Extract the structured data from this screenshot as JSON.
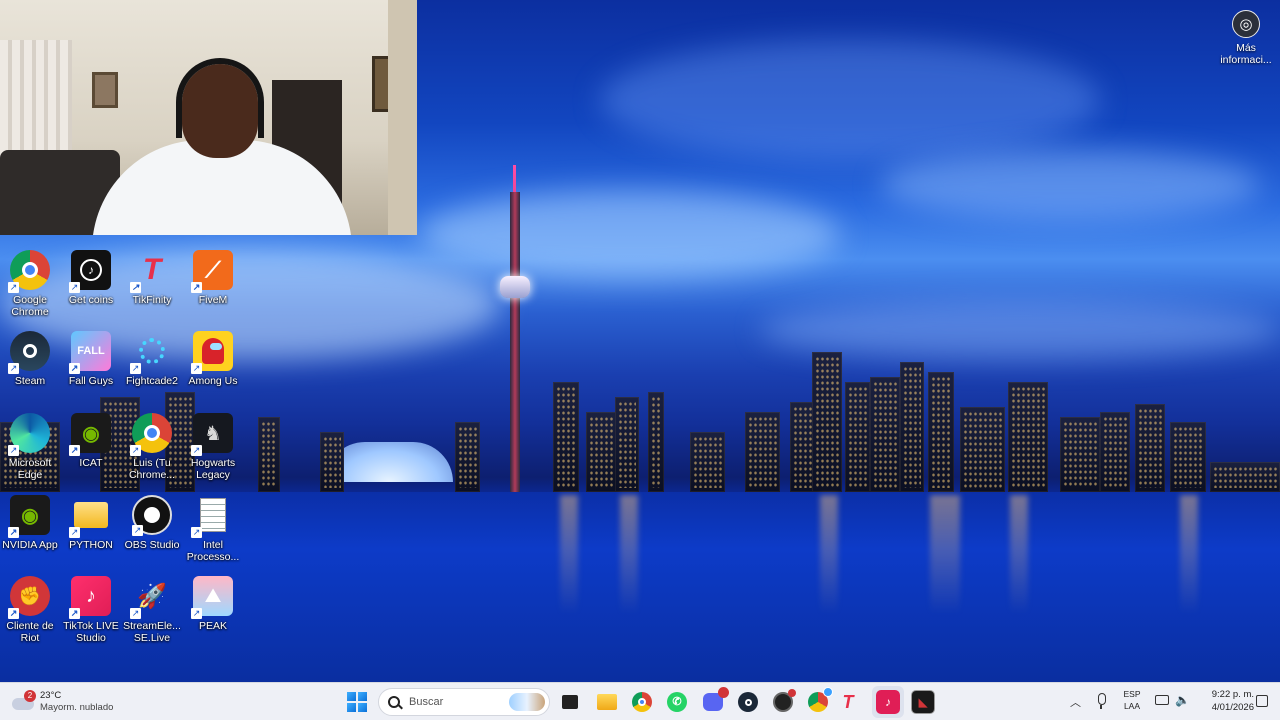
{
  "desktop": {
    "icons": [
      {
        "label": "Google Chrome",
        "icon": "chrome-icon"
      },
      {
        "label": "Get coins",
        "icon": "tiktok-coins-icon"
      },
      {
        "label": "TikFinity",
        "icon": "tikfinity-icon"
      },
      {
        "label": "FiveM",
        "icon": "fivem-icon"
      },
      {
        "label": "Steam",
        "icon": "steam-icon"
      },
      {
        "label": "Fall Guys",
        "icon": "fall-guys-icon"
      },
      {
        "label": "Fightcade2",
        "icon": "fightcade-icon"
      },
      {
        "label": "Among Us",
        "icon": "among-us-icon"
      },
      {
        "label": "Microsoft Edge",
        "icon": "edge-icon"
      },
      {
        "label": "ICAT",
        "icon": "nvidia-icon"
      },
      {
        "label": "Luis (Tu Chrome...",
        "icon": "chrome-profile-icon"
      },
      {
        "label": "Hogwarts Legacy",
        "icon": "hogwarts-icon"
      },
      {
        "label": "NVIDIA App",
        "icon": "nvidia-app-icon"
      },
      {
        "label": "PYTHON",
        "icon": "folder-icon"
      },
      {
        "label": "OBS Studio",
        "icon": "obs-icon"
      },
      {
        "label": "Intel Processo...",
        "icon": "document-icon"
      },
      {
        "label": "Cliente de Riot",
        "icon": "riot-icon"
      },
      {
        "label": "TikTok LIVE Studio",
        "icon": "tiktok-live-icon"
      },
      {
        "label": "StreamEle... SE.Live",
        "icon": "streamelements-icon"
      },
      {
        "label": "PEAK",
        "icon": "peak-icon"
      }
    ],
    "more_info_label": "Más informaci..."
  },
  "taskbar": {
    "weather": {
      "temp": "23°C",
      "condition": "Mayorm. nublado",
      "badge": "2"
    },
    "search_placeholder": "Buscar",
    "apps": [
      {
        "icon": "task-view-icon"
      },
      {
        "icon": "file-explorer-icon"
      },
      {
        "icon": "chrome-icon"
      },
      {
        "icon": "whatsapp-icon"
      },
      {
        "icon": "discord-icon"
      },
      {
        "icon": "steam-icon"
      },
      {
        "icon": "obs-icon"
      },
      {
        "icon": "chrome-profile-icon"
      },
      {
        "icon": "tikfinity-icon"
      },
      {
        "icon": "tiktok-live-icon"
      },
      {
        "icon": "capcut-icon"
      }
    ],
    "tray": {
      "language_top": "ESP",
      "language_bottom": "LAA",
      "time": "9:22 p. m.",
      "date": "4/01/2026"
    }
  }
}
